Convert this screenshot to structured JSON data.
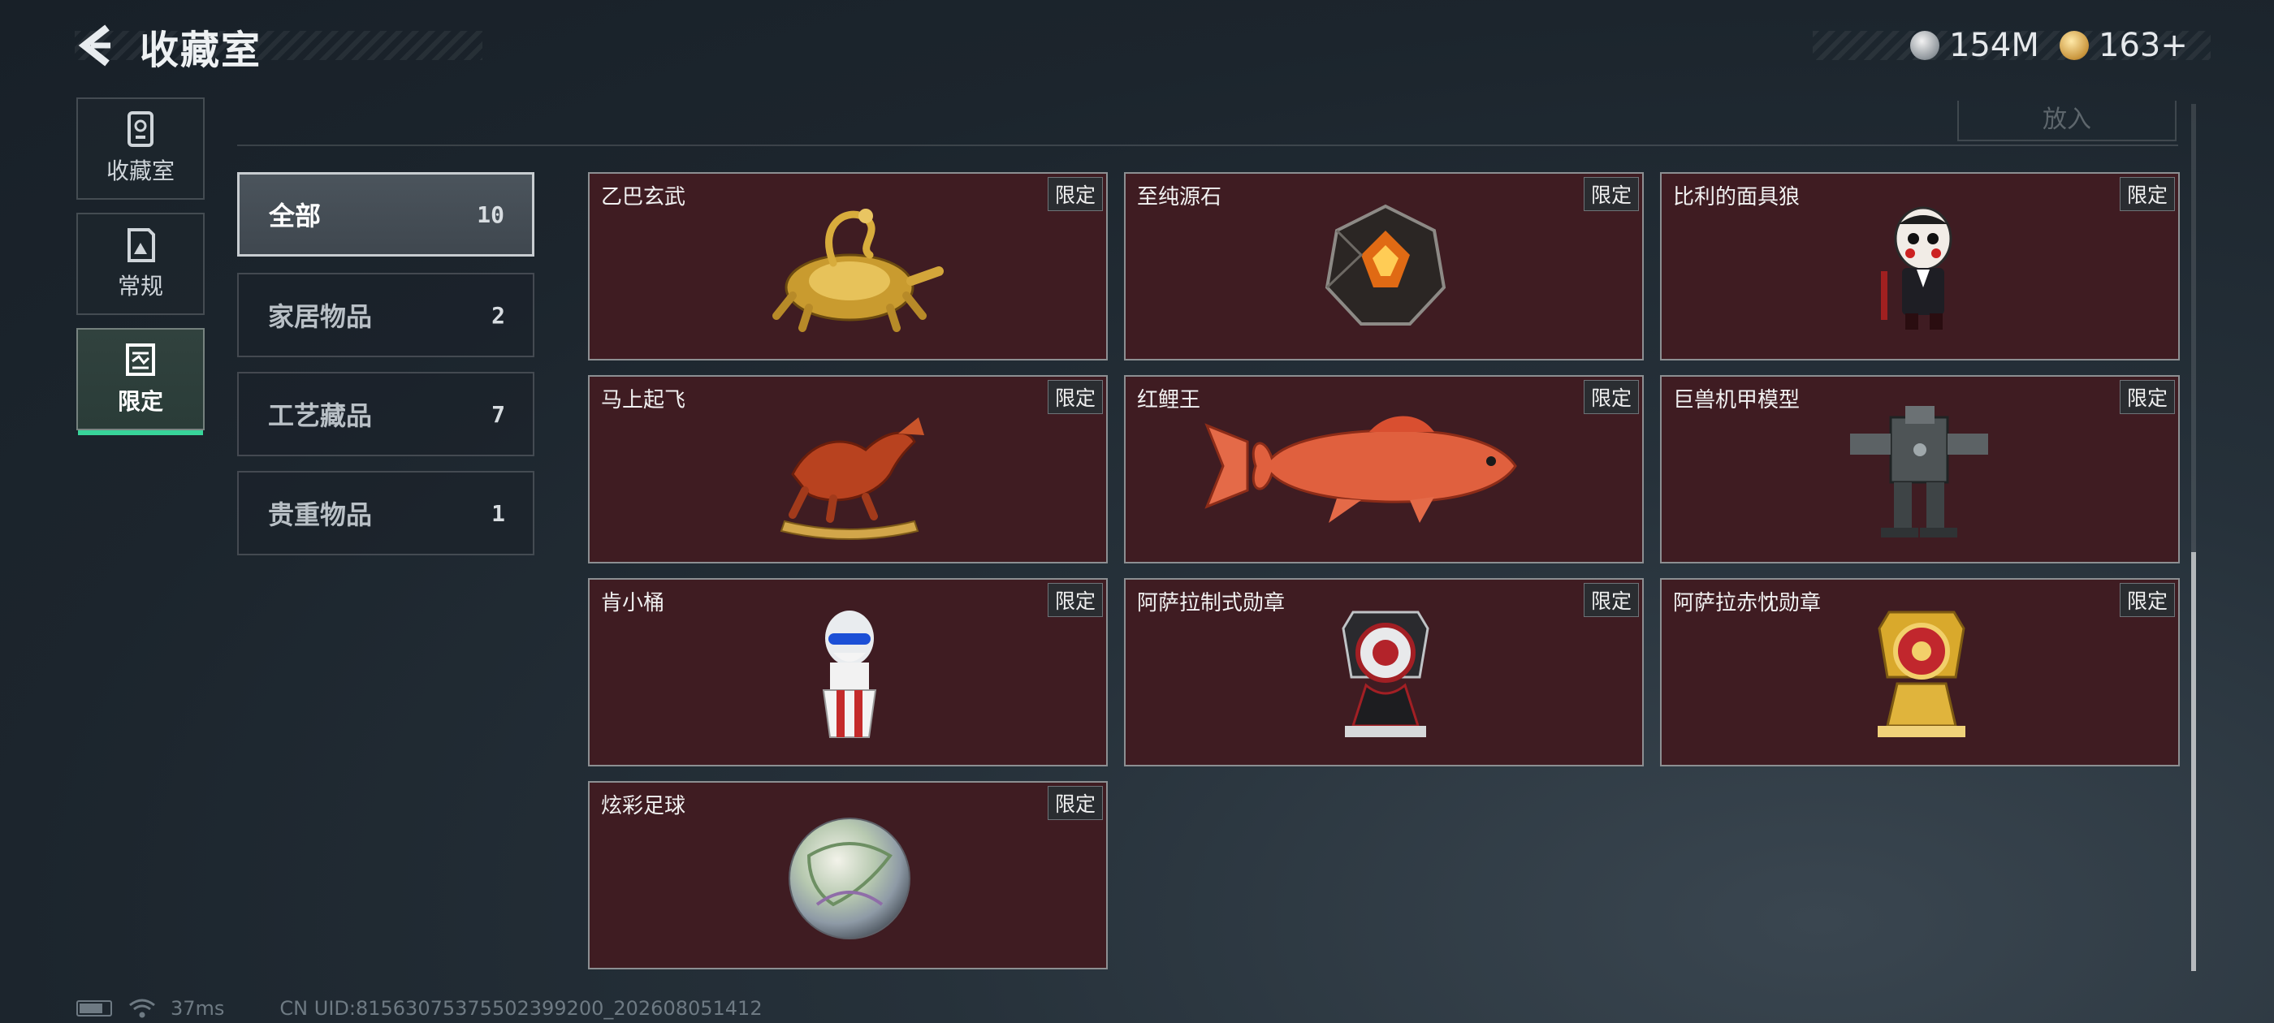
{
  "header": {
    "title": "收藏室",
    "currencies": [
      {
        "value": "154M",
        "icon": "silver-coin-icon"
      },
      {
        "value": "163+",
        "icon": "gold-coin-icon"
      }
    ]
  },
  "nav": {
    "tabs": [
      {
        "label": "收藏室",
        "icon": "trophy-shelf-icon"
      },
      {
        "label": "常规",
        "icon": "picture-frame-icon"
      },
      {
        "label": "限定",
        "icon": "limited-frame-icon",
        "active": true
      }
    ]
  },
  "top": {
    "button_label": "放入"
  },
  "filters": [
    {
      "name": "全部",
      "count": "10",
      "active": true
    },
    {
      "name": "家居物品",
      "count": "2"
    },
    {
      "name": "工艺藏品",
      "count": "7"
    },
    {
      "name": "贵重物品",
      "count": "1"
    }
  ],
  "items": [
    {
      "name": "乙巴玄武",
      "tag": "限定",
      "icon": "golden-turtle-snake-icon"
    },
    {
      "name": "至纯源石",
      "tag": "限定",
      "icon": "dark-crystal-icon"
    },
    {
      "name": "比利的面具狼",
      "tag": "限定",
      "icon": "billy-puppet-icon"
    },
    {
      "name": "马上起飞",
      "tag": "限定",
      "icon": "red-horse-statue-icon"
    },
    {
      "name": "红鲤王",
      "tag": "限定",
      "icon": "red-carp-icon"
    },
    {
      "name": "巨兽机甲模型",
      "tag": "限定",
      "icon": "mech-model-icon"
    },
    {
      "name": "肯小桶",
      "tag": "限定",
      "icon": "colonel-bucket-icon"
    },
    {
      "name": "阿萨拉制式勋章",
      "tag": "限定",
      "icon": "silver-medal-icon"
    },
    {
      "name": "阿萨拉赤忱勋章",
      "tag": "限定",
      "icon": "gold-medal-icon"
    },
    {
      "name": "炫彩足球",
      "tag": "限定",
      "icon": "iridescent-football-icon"
    }
  ],
  "footer": {
    "ping": "37ms",
    "uid": "CN UID:815630753755023992​00_202608051412"
  },
  "colors": {
    "accent": "#38d49a",
    "card_bg": "#3f1c22"
  }
}
